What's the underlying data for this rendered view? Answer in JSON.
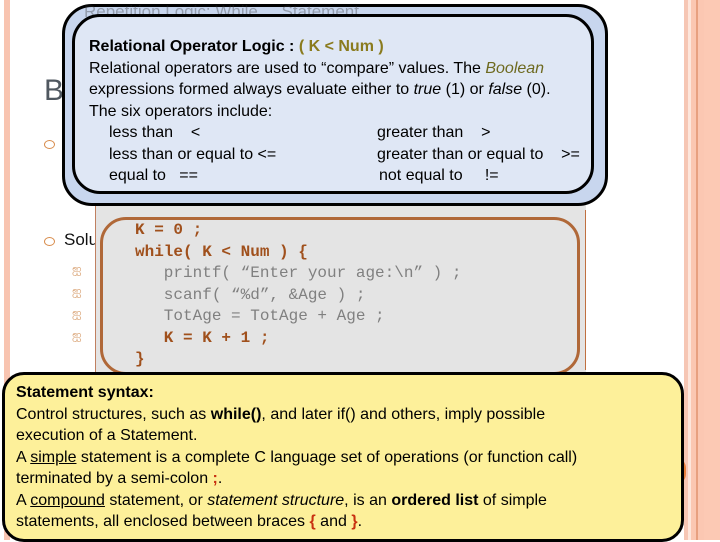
{
  "background_slide": {
    "title_fragment": "B",
    "hidden_heading": "Repetition Logic: While ... Statement",
    "solution_label": "Solu",
    "sub_bullet_glyph": "ஐ"
  },
  "relational_box": {
    "title": "Relational Operator Logic : ",
    "title_expr": "( K < Num )",
    "line1_a": "Relational operators are used to “compare” values.  The ",
    "line1_boolean": "Boolean",
    "line2_a": "expressions formed always evaluate either to ",
    "line2_true": "true",
    "line2_b": " (1) or ",
    "line2_false": "false",
    "line2_c": " (0).",
    "line3": "The six operators include:",
    "operators": [
      {
        "name": "less than",
        "symbol": "<"
      },
      {
        "name": "greater than",
        "symbol": ">"
      },
      {
        "name": "less than or equal to",
        "symbol": "<="
      },
      {
        "name": "greater than or equal to",
        "symbol": ">="
      },
      {
        "name": "equal to",
        "symbol": "=="
      },
      {
        "name": "not equal to",
        "symbol": "!="
      }
    ]
  },
  "code_box": {
    "lines": [
      "K = 0 ;",
      "while( K < Num ) {",
      "   printf( “Enter your age:\\n” ) ;",
      "   scanf( “%d”, &Age ) ;",
      "   TotAge = TotAge + Age ;",
      "   K = K + 1 ;",
      "}"
    ]
  },
  "statement_box": {
    "title": "Statement syntax:",
    "l1_a": "Control structures, such as ",
    "l1_while": "while()",
    "l1_b": ", and later if() and others, imply possible",
    "l2": "execution of a Statement.",
    "l3_a": "A ",
    "l3_simple": "simple",
    "l3_b": " statement is a complete C language set of operations (or function call)",
    "l4_a": "terminated by a semi-colon ",
    "l4_semi": ";",
    "l4_b": ".",
    "l5_a": "A ",
    "l5_compound": "compound",
    "l5_b": " statement, or ",
    "l5_struct": "statement structure",
    "l5_c": ", is an ",
    "l5_ordered": "ordered list",
    "l5_d": " of simple",
    "l6_a": "statements, all enclosed between braces ",
    "l6_open": "{",
    "l6_and": " and ",
    "l6_close": "}",
    "l6_b": "."
  },
  "colors": {
    "relational_fill": "#dfe7f5",
    "relational_outer": "#c8d6ee",
    "code_border": "#b06838",
    "code_keyword": "#a0501c",
    "statement_fill": "#fdf09a",
    "accent_red": "#c83010",
    "accent_olive": "#8a7b1e"
  }
}
